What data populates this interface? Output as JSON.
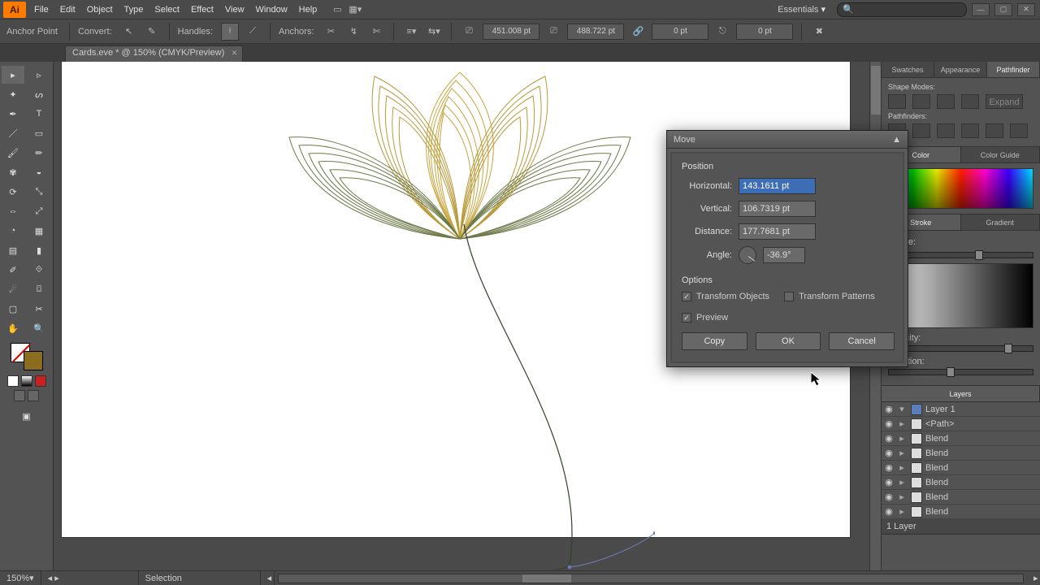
{
  "app": {
    "logo": "Ai"
  },
  "menu": [
    "File",
    "Edit",
    "Object",
    "Type",
    "Select",
    "Effect",
    "View",
    "Window",
    "Help"
  ],
  "workspace_preset": "Essentials",
  "search_placeholder": "",
  "control": {
    "context": "Anchor Point",
    "convert": "Convert:",
    "handles": "Handles:",
    "anchors": "Anchors:",
    "fieldA": "451.008 pt",
    "fieldB": "488.722 pt",
    "fieldC": "0 pt",
    "fieldD": "0 pt"
  },
  "doctab": {
    "label": "Cards.eve * @ 150% (CMYK/Preview)"
  },
  "dialog": {
    "title": "Move",
    "section_position": "Position",
    "lbl_h": "Horizontal:",
    "val_h": "143.1611 pt",
    "lbl_v": "Vertical:",
    "val_v": "106.7319 pt",
    "lbl_d": "Distance:",
    "val_d": "177.7681 pt",
    "lbl_a": "Angle:",
    "val_a": "-36.9°",
    "section_options": "Options",
    "opt_objects": "Transform Objects",
    "opt_patterns": "Transform Patterns",
    "opt_preview": "Preview",
    "btn_copy": "Copy",
    "btn_ok": "OK",
    "btn_cancel": "Cancel"
  },
  "panels": {
    "top_tabs": [
      "Swatches",
      "Appearance",
      "Pathfinder"
    ],
    "shape_modes": "Shape Modes:",
    "pathfinders": "Pathfinders:",
    "expand": "Expand",
    "color_tabs": [
      "Color",
      "Color Guide"
    ],
    "stroke_tab": "Stroke",
    "gradient_tab": "Gradient",
    "type_lbl": "Type:",
    "opacity_lbl": "Opacity:",
    "location_lbl": "Location:",
    "layers_tab": "Layers",
    "layer_top": "Layer 1",
    "items": [
      "<Path>",
      "Blend",
      "Blend",
      "Blend",
      "Blend",
      "Blend",
      "Blend"
    ],
    "layer_footer": "1 Layer"
  },
  "status": {
    "zoom": "150%",
    "mode": "Selection"
  }
}
